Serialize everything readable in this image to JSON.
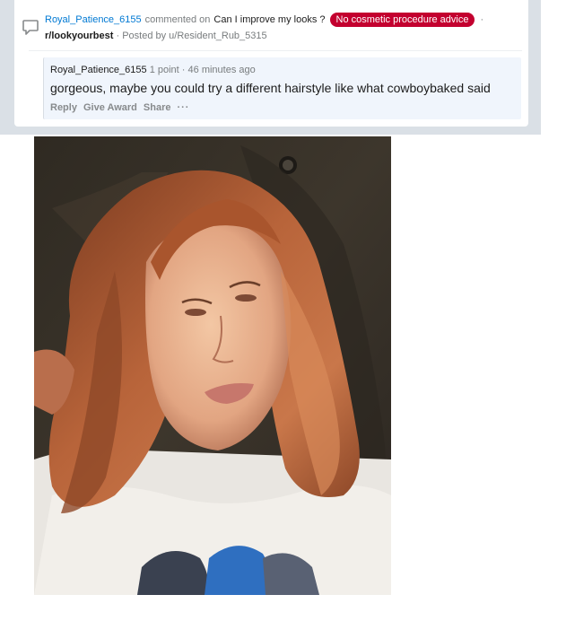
{
  "activity": {
    "commenter": "Royal_Patience_6155",
    "action_text": "commented on",
    "post_title": "Can I improve my looks ?",
    "flair": "No cosmetic procedure advice",
    "separator": "·",
    "subreddit": "r/lookyourbest",
    "posted_by": "· Posted by u/Resident_Rub_5315"
  },
  "comment": {
    "author": "Royal_Patience_6155",
    "points": "1 point",
    "separator": "·",
    "time": "46 minutes ago",
    "body": "gorgeous, maybe you could try a different hairstyle like what cowboybaked said",
    "actions": {
      "reply": "Reply",
      "give_award": "Give Award",
      "share": "Share",
      "more": "···"
    }
  },
  "colors": {
    "link_blue": "#0079d3",
    "flair_red": "#c3002f",
    "band_gray": "#dae0e6",
    "comment_bg": "#f0f5fc"
  },
  "icons": {
    "comment": "speech-bubble-icon",
    "more": "ellipsis-icon"
  }
}
